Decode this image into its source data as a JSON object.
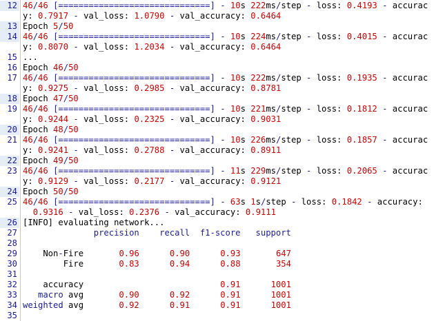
{
  "lines": [
    {
      "num": "12",
      "hl": true,
      "segs": [
        [
          "n",
          "46"
        ],
        [
          "m",
          "/"
        ],
        [
          "n",
          "46"
        ],
        [
          "t",
          " "
        ],
        [
          "m",
          "[==============================]"
        ],
        [
          "t",
          " "
        ],
        [
          "m",
          "-"
        ],
        [
          "t",
          " "
        ],
        [
          "n",
          "10"
        ],
        [
          "t",
          "s "
        ],
        [
          "n",
          "222"
        ],
        [
          "t",
          "ms"
        ],
        [
          "m",
          "/"
        ],
        [
          "t",
          "step "
        ],
        [
          "m",
          "-"
        ],
        [
          "t",
          " loss: "
        ],
        [
          "n",
          "0.4193"
        ],
        [
          "t",
          " "
        ],
        [
          "m",
          "-"
        ],
        [
          "t",
          " accurac"
        ]
      ]
    },
    {
      "num": "",
      "hl": false,
      "segs": [
        [
          "t",
          "y: "
        ],
        [
          "n",
          "0.7917"
        ],
        [
          "t",
          " "
        ],
        [
          "m",
          "-"
        ],
        [
          "t",
          " val_loss: "
        ],
        [
          "n",
          "1.0790"
        ],
        [
          "t",
          " "
        ],
        [
          "m",
          "-"
        ],
        [
          "t",
          " val_accuracy: "
        ],
        [
          "n",
          "0.6464"
        ]
      ]
    },
    {
      "num": "13",
      "hl": true,
      "segs": [
        [
          "t",
          "Epoch "
        ],
        [
          "n",
          "5"
        ],
        [
          "m",
          "/"
        ],
        [
          "n",
          "50"
        ]
      ]
    },
    {
      "num": "14",
      "hl": true,
      "segs": [
        [
          "n",
          "46"
        ],
        [
          "m",
          "/"
        ],
        [
          "n",
          "46"
        ],
        [
          "t",
          " "
        ],
        [
          "m",
          "[==============================]"
        ],
        [
          "t",
          " "
        ],
        [
          "m",
          "-"
        ],
        [
          "t",
          " "
        ],
        [
          "n",
          "10"
        ],
        [
          "t",
          "s "
        ],
        [
          "n",
          "224"
        ],
        [
          "t",
          "ms"
        ],
        [
          "m",
          "/"
        ],
        [
          "t",
          "step "
        ],
        [
          "m",
          "-"
        ],
        [
          "t",
          " loss: "
        ],
        [
          "n",
          "0.4015"
        ],
        [
          "t",
          " "
        ],
        [
          "m",
          "-"
        ],
        [
          "t",
          " accurac"
        ]
      ]
    },
    {
      "num": "",
      "hl": false,
      "segs": [
        [
          "t",
          "y: "
        ],
        [
          "n",
          "0.8070"
        ],
        [
          "t",
          " "
        ],
        [
          "m",
          "-"
        ],
        [
          "t",
          " val_loss: "
        ],
        [
          "n",
          "1.2034"
        ],
        [
          "t",
          " "
        ],
        [
          "m",
          "-"
        ],
        [
          "t",
          " val_accuracy: "
        ],
        [
          "n",
          "0.6464"
        ]
      ]
    },
    {
      "num": "15",
      "hl": false,
      "segs": [
        [
          "t",
          "..."
        ]
      ]
    },
    {
      "num": "16",
      "hl": false,
      "segs": [
        [
          "t",
          "Epoch "
        ],
        [
          "n",
          "46"
        ],
        [
          "m",
          "/"
        ],
        [
          "n",
          "50"
        ]
      ]
    },
    {
      "num": "17",
      "hl": false,
      "segs": [
        [
          "n",
          "46"
        ],
        [
          "m",
          "/"
        ],
        [
          "n",
          "46"
        ],
        [
          "t",
          " "
        ],
        [
          "m",
          "[==============================]"
        ],
        [
          "t",
          " "
        ],
        [
          "m",
          "-"
        ],
        [
          "t",
          " "
        ],
        [
          "n",
          "10"
        ],
        [
          "t",
          "s "
        ],
        [
          "n",
          "222"
        ],
        [
          "t",
          "ms"
        ],
        [
          "m",
          "/"
        ],
        [
          "t",
          "step "
        ],
        [
          "m",
          "-"
        ],
        [
          "t",
          " loss: "
        ],
        [
          "n",
          "0.1935"
        ],
        [
          "t",
          " "
        ],
        [
          "m",
          "-"
        ],
        [
          "t",
          " accurac"
        ]
      ]
    },
    {
      "num": "",
      "hl": false,
      "segs": [
        [
          "t",
          "y: "
        ],
        [
          "n",
          "0.9275"
        ],
        [
          "t",
          " "
        ],
        [
          "m",
          "-"
        ],
        [
          "t",
          " val_loss: "
        ],
        [
          "n",
          "0.2985"
        ],
        [
          "t",
          " "
        ],
        [
          "m",
          "-"
        ],
        [
          "t",
          " val_accuracy: "
        ],
        [
          "n",
          "0.8781"
        ]
      ]
    },
    {
      "num": "18",
      "hl": true,
      "segs": [
        [
          "t",
          "Epoch "
        ],
        [
          "n",
          "47"
        ],
        [
          "m",
          "/"
        ],
        [
          "n",
          "50"
        ]
      ]
    },
    {
      "num": "19",
      "hl": false,
      "segs": [
        [
          "n",
          "46"
        ],
        [
          "m",
          "/"
        ],
        [
          "n",
          "46"
        ],
        [
          "t",
          " "
        ],
        [
          "m",
          "[==============================]"
        ],
        [
          "t",
          " "
        ],
        [
          "m",
          "-"
        ],
        [
          "t",
          " "
        ],
        [
          "n",
          "10"
        ],
        [
          "t",
          "s "
        ],
        [
          "n",
          "221"
        ],
        [
          "t",
          "ms"
        ],
        [
          "m",
          "/"
        ],
        [
          "t",
          "step "
        ],
        [
          "m",
          "-"
        ],
        [
          "t",
          " loss: "
        ],
        [
          "n",
          "0.1812"
        ],
        [
          "t",
          " "
        ],
        [
          "m",
          "-"
        ],
        [
          "t",
          " accurac"
        ]
      ]
    },
    {
      "num": "",
      "hl": false,
      "segs": [
        [
          "t",
          "y: "
        ],
        [
          "n",
          "0.9244"
        ],
        [
          "t",
          " "
        ],
        [
          "m",
          "-"
        ],
        [
          "t",
          " val_loss: "
        ],
        [
          "n",
          "0.2325"
        ],
        [
          "t",
          " "
        ],
        [
          "m",
          "-"
        ],
        [
          "t",
          " val_accuracy: "
        ],
        [
          "n",
          "0.9031"
        ]
      ]
    },
    {
      "num": "20",
      "hl": true,
      "segs": [
        [
          "t",
          "Epoch "
        ],
        [
          "n",
          "48"
        ],
        [
          "m",
          "/"
        ],
        [
          "n",
          "50"
        ]
      ]
    },
    {
      "num": "21",
      "hl": false,
      "segs": [
        [
          "n",
          "46"
        ],
        [
          "m",
          "/"
        ],
        [
          "n",
          "46"
        ],
        [
          "t",
          " "
        ],
        [
          "m",
          "[==============================]"
        ],
        [
          "t",
          " "
        ],
        [
          "m",
          "-"
        ],
        [
          "t",
          " "
        ],
        [
          "n",
          "10"
        ],
        [
          "t",
          "s "
        ],
        [
          "n",
          "226"
        ],
        [
          "t",
          "ms"
        ],
        [
          "m",
          "/"
        ],
        [
          "t",
          "step "
        ],
        [
          "m",
          "-"
        ],
        [
          "t",
          " loss: "
        ],
        [
          "n",
          "0.1857"
        ],
        [
          "t",
          " "
        ],
        [
          "m",
          "-"
        ],
        [
          "t",
          " accurac"
        ]
      ]
    },
    {
      "num": "",
      "hl": false,
      "segs": [
        [
          "t",
          "y: "
        ],
        [
          "n",
          "0.9241"
        ],
        [
          "t",
          " "
        ],
        [
          "m",
          "-"
        ],
        [
          "t",
          " val_loss: "
        ],
        [
          "n",
          "0.2788"
        ],
        [
          "t",
          " "
        ],
        [
          "m",
          "-"
        ],
        [
          "t",
          " val_accuracy: "
        ],
        [
          "n",
          "0.8911"
        ]
      ]
    },
    {
      "num": "22",
      "hl": true,
      "segs": [
        [
          "t",
          "Epoch "
        ],
        [
          "n",
          "49"
        ],
        [
          "m",
          "/"
        ],
        [
          "n",
          "50"
        ]
      ]
    },
    {
      "num": "23",
      "hl": false,
      "segs": [
        [
          "n",
          "46"
        ],
        [
          "m",
          "/"
        ],
        [
          "n",
          "46"
        ],
        [
          "t",
          " "
        ],
        [
          "m",
          "[==============================]"
        ],
        [
          "t",
          " "
        ],
        [
          "m",
          "-"
        ],
        [
          "t",
          " "
        ],
        [
          "n",
          "11"
        ],
        [
          "t",
          "s "
        ],
        [
          "n",
          "229"
        ],
        [
          "t",
          "ms"
        ],
        [
          "m",
          "/"
        ],
        [
          "t",
          "step "
        ],
        [
          "m",
          "-"
        ],
        [
          "t",
          " loss: "
        ],
        [
          "n",
          "0.2065"
        ],
        [
          "t",
          " "
        ],
        [
          "m",
          "-"
        ],
        [
          "t",
          " accurac"
        ]
      ]
    },
    {
      "num": "",
      "hl": false,
      "segs": [
        [
          "t",
          "y: "
        ],
        [
          "n",
          "0.9129"
        ],
        [
          "t",
          " "
        ],
        [
          "m",
          "-"
        ],
        [
          "t",
          " val_loss: "
        ],
        [
          "n",
          "0.2177"
        ],
        [
          "t",
          " "
        ],
        [
          "m",
          "-"
        ],
        [
          "t",
          " val_accuracy: "
        ],
        [
          "n",
          "0.9121"
        ]
      ]
    },
    {
      "num": "24",
      "hl": true,
      "segs": [
        [
          "t",
          "Epoch "
        ],
        [
          "n",
          "50"
        ],
        [
          "m",
          "/"
        ],
        [
          "n",
          "50"
        ]
      ]
    },
    {
      "num": "25",
      "hl": false,
      "segs": [
        [
          "n",
          "46"
        ],
        [
          "m",
          "/"
        ],
        [
          "n",
          "46"
        ],
        [
          "t",
          " "
        ],
        [
          "m",
          "[==============================]"
        ],
        [
          "t",
          " "
        ],
        [
          "m",
          "-"
        ],
        [
          "t",
          " "
        ],
        [
          "n",
          "63"
        ],
        [
          "t",
          "s "
        ],
        [
          "n",
          "1"
        ],
        [
          "t",
          "s"
        ],
        [
          "m",
          "/"
        ],
        [
          "t",
          "step "
        ],
        [
          "m",
          "-"
        ],
        [
          "t",
          " loss: "
        ],
        [
          "n",
          "0.1842"
        ],
        [
          "t",
          " "
        ],
        [
          "m",
          "-"
        ],
        [
          "t",
          " accuracy:"
        ]
      ]
    },
    {
      "num": "",
      "hl": false,
      "segs": [
        [
          "t",
          "  "
        ],
        [
          "n",
          "0.9316"
        ],
        [
          "t",
          " "
        ],
        [
          "m",
          "-"
        ],
        [
          "t",
          " val_loss: "
        ],
        [
          "n",
          "0.2376"
        ],
        [
          "t",
          " "
        ],
        [
          "m",
          "-"
        ],
        [
          "t",
          " val_accuracy: "
        ],
        [
          "n",
          "0.9111"
        ]
      ]
    },
    {
      "num": "26",
      "hl": true,
      "segs": [
        [
          "t",
          "[INFO] evaluating network..."
        ]
      ]
    },
    {
      "num": "27",
      "hl": false,
      "segs": [
        [
          "t",
          "              "
        ],
        [
          "m",
          "precision    recall  f1-score   support"
        ]
      ]
    },
    {
      "num": "28",
      "hl": false,
      "segs": []
    },
    {
      "num": "29",
      "hl": false,
      "segs": [
        [
          "t",
          "    Non"
        ],
        [
          "m",
          "-"
        ],
        [
          "t",
          "Fire       "
        ],
        [
          "n",
          "0.96"
        ],
        [
          "t",
          "      "
        ],
        [
          "n",
          "0.90"
        ],
        [
          "t",
          "      "
        ],
        [
          "n",
          "0.93"
        ],
        [
          "t",
          "       "
        ],
        [
          "n",
          "647"
        ]
      ]
    },
    {
      "num": "30",
      "hl": false,
      "segs": [
        [
          "t",
          "        Fire       "
        ],
        [
          "n",
          "0.83"
        ],
        [
          "t",
          "      "
        ],
        [
          "n",
          "0.94"
        ],
        [
          "t",
          "      "
        ],
        [
          "n",
          "0.88"
        ],
        [
          "t",
          "       "
        ],
        [
          "n",
          "354"
        ]
      ]
    },
    {
      "num": "31",
      "hl": false,
      "segs": []
    },
    {
      "num": "32",
      "hl": false,
      "segs": [
        [
          "t",
          "    accuracy                           "
        ],
        [
          "n",
          "0.91"
        ],
        [
          "t",
          "      "
        ],
        [
          "n",
          "1001"
        ]
      ]
    },
    {
      "num": "33",
      "hl": false,
      "segs": [
        [
          "t",
          "   "
        ],
        [
          "m",
          "macro"
        ],
        [
          "t",
          " avg       "
        ],
        [
          "n",
          "0.90"
        ],
        [
          "t",
          "      "
        ],
        [
          "n",
          "0.92"
        ],
        [
          "t",
          "      "
        ],
        [
          "n",
          "0.91"
        ],
        [
          "t",
          "      "
        ],
        [
          "n",
          "1001"
        ]
      ]
    },
    {
      "num": "34",
      "hl": false,
      "segs": [
        [
          "m",
          "weighted"
        ],
        [
          "t",
          " avg       "
        ],
        [
          "n",
          "0.92"
        ],
        [
          "t",
          "      "
        ],
        [
          "n",
          "0.91"
        ],
        [
          "t",
          "      "
        ],
        [
          "n",
          "0.91"
        ],
        [
          "t",
          "      "
        ],
        [
          "n",
          "1001"
        ]
      ]
    },
    {
      "num": "35",
      "hl": false,
      "segs": []
    }
  ]
}
